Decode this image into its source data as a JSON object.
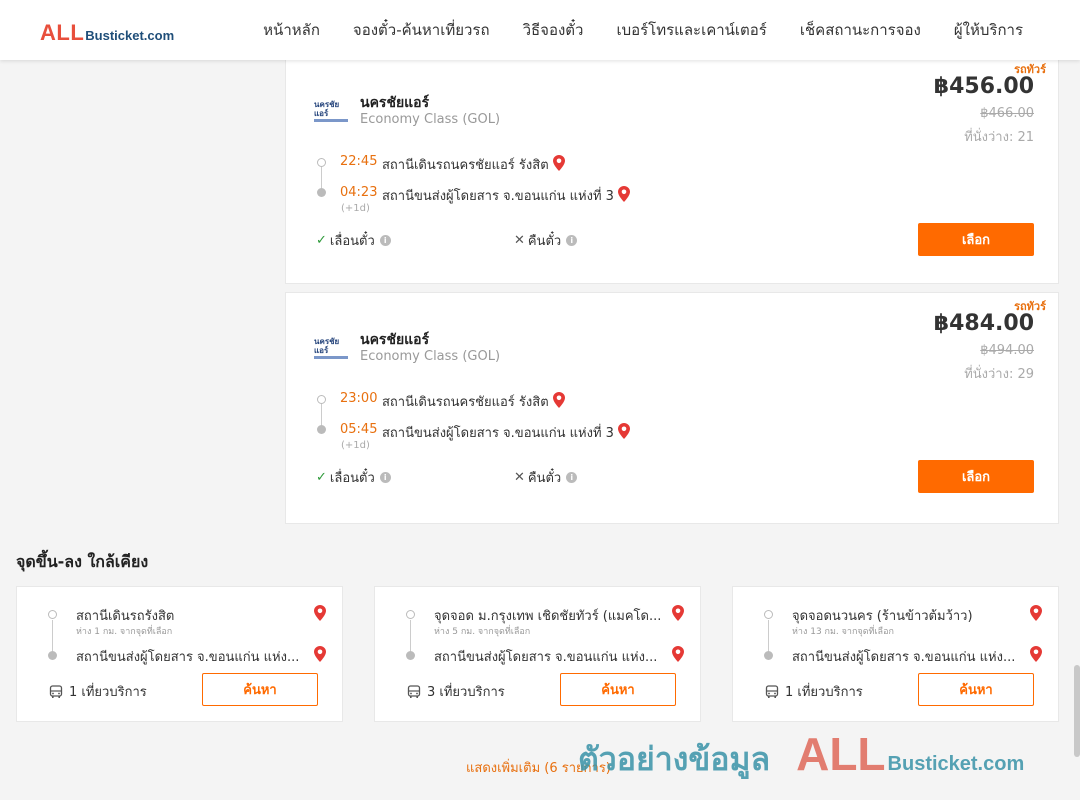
{
  "logo": {
    "main": "ALL",
    "rest": "Busticket.com"
  },
  "nav": [
    "หน้าหลัก",
    "จองตั๋ว-ค้นหาเที่ยวรถ",
    "วิธีจองตั๋ว",
    "เบอร์โทรและเคาน์เตอร์",
    "เช็คสถานะการจอง",
    "ผู้ให้บริการ"
  ],
  "trips": [
    {
      "tag": "รถทัวร์",
      "operator_logo": "นครชัยแอร์",
      "operator": "นครชัยแอร์",
      "class": "Economy Class (GOL)",
      "price": "฿456.00",
      "old_price": "฿466.00",
      "seats": "ที่นั่งว่าง: 21",
      "dep_time": "22:45",
      "dep_station": "สถานีเดินรถนครชัยแอร์ รังสิต",
      "arr_time": "04:23",
      "arr_station": "สถานีขนส่งผู้โดยสาร จ.ขอนแก่น แห่งที่ 3",
      "plus_day": "(+1d)",
      "opt_change": "เลื่อนตั๋ว",
      "opt_refund": "คืนตั๋ว",
      "select": "เลือก"
    },
    {
      "tag": "รถทัวร์",
      "operator_logo": "นครชัยแอร์",
      "operator": "นครชัยแอร์",
      "class": "Economy Class (GOL)",
      "price": "฿484.00",
      "old_price": "฿494.00",
      "seats": "ที่นั่งว่าง: 29",
      "dep_time": "23:00",
      "dep_station": "สถานีเดินรถนครชัยแอร์ รังสิต",
      "arr_time": "05:45",
      "arr_station": "สถานีขนส่งผู้โดยสาร จ.ขอนแก่น แห่งที่ 3",
      "plus_day": "(+1d)",
      "opt_change": "เลื่อนตั๋ว",
      "opt_refund": "คืนตั๋ว",
      "select": "เลือก"
    }
  ],
  "nearby": {
    "title": "จุดขึ้น-ลง ใกล้เคียง",
    "items": [
      {
        "from": "สถานีเดินรถรังสิต",
        "dist": "ห่าง 1 กม. จากจุดที่เลือก",
        "to": "สถานีขนส่งผู้โดยสาร จ.ขอนแก่น แห่ง...",
        "count": "1 เที่ยวบริการ",
        "button": "ค้นหา"
      },
      {
        "from": "จุดจอด ม.กรุงเทพ เชิดชัยทัวร์ (แมคโด...",
        "dist": "ห่าง 5 กม. จากจุดที่เลือก",
        "to": "สถานีขนส่งผู้โดยสาร จ.ขอนแก่น แห่ง...",
        "count": "3 เที่ยวบริการ",
        "button": "ค้นหา"
      },
      {
        "from": "จุดจอดนวนคร (ร้านข้าวต้มว้าว)",
        "dist": "ห่าง 13 กม. จากจุดที่เลือก",
        "to": "สถานีขนส่งผู้โดยสาร จ.ขอนแก่น แห่ง...",
        "count": "1 เที่ยวบริการ",
        "button": "ค้นหา"
      }
    ]
  },
  "more": "แสดงเพิ่มเติม (6 รายการ)",
  "watermark": {
    "text": "ตัวอย่างข้อมูล",
    "main": "ALL",
    "rest": "Busticket.com"
  },
  "colors": {
    "accent": "#ff6a00",
    "time": "#e8700f",
    "logo_red": "#e84f3c",
    "logo_blue": "#1f4e79"
  }
}
